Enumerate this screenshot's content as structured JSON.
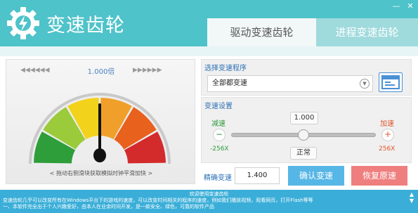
{
  "app": {
    "title": "变速齿轮"
  },
  "window": {
    "min_icon": "minimize-icon",
    "close_icon": "close-icon"
  },
  "tabs": [
    {
      "label": "驱动变速齿轮"
    },
    {
      "label": "进程变速齿轮"
    }
  ],
  "gauge": {
    "speed_text": "1.000倍",
    "hint": "< 拖动右侧滑块获取模拟时钟平滑加快 >",
    "colors": [
      "#2e9e3a",
      "#9bcb3b",
      "#f2d21b",
      "#f0a02a",
      "#e8611d",
      "#d32b2b"
    ],
    "needle_fraction": 0.5
  },
  "process": {
    "section_title": "选择变速程序",
    "selected": "全部都变速"
  },
  "speed_settings": {
    "section_title": "变速设置",
    "current": "1.000",
    "slow_label": "减速",
    "fast_label": "加速",
    "min": "-256X",
    "max": "256X",
    "normal_button": "正常",
    "slider_fraction": 0.5
  },
  "exact": {
    "label": "精确变速",
    "value": "1.400",
    "confirm_button": "确认变速",
    "restore_button": "恢复原速"
  },
  "footer": {
    "welcome": "欢迎使用变速齿轮",
    "line1": "变速齿轮几乎可以改变所有在Windows平台下的游戏的速度，可以改变时间相关的程序的速度，例如我们播放视频，观看网页，打开Flash等等",
    "line2": "一、本软件完全出于个人兴趣爱好，由本人在业余时间开发，是一款安全、绿色，可靠的软件产品"
  },
  "colors": {
    "header": "#4ec3c9",
    "footer": "#3aaed8",
    "confirm": "#56b6e6",
    "restore": "#ef7f7f"
  }
}
